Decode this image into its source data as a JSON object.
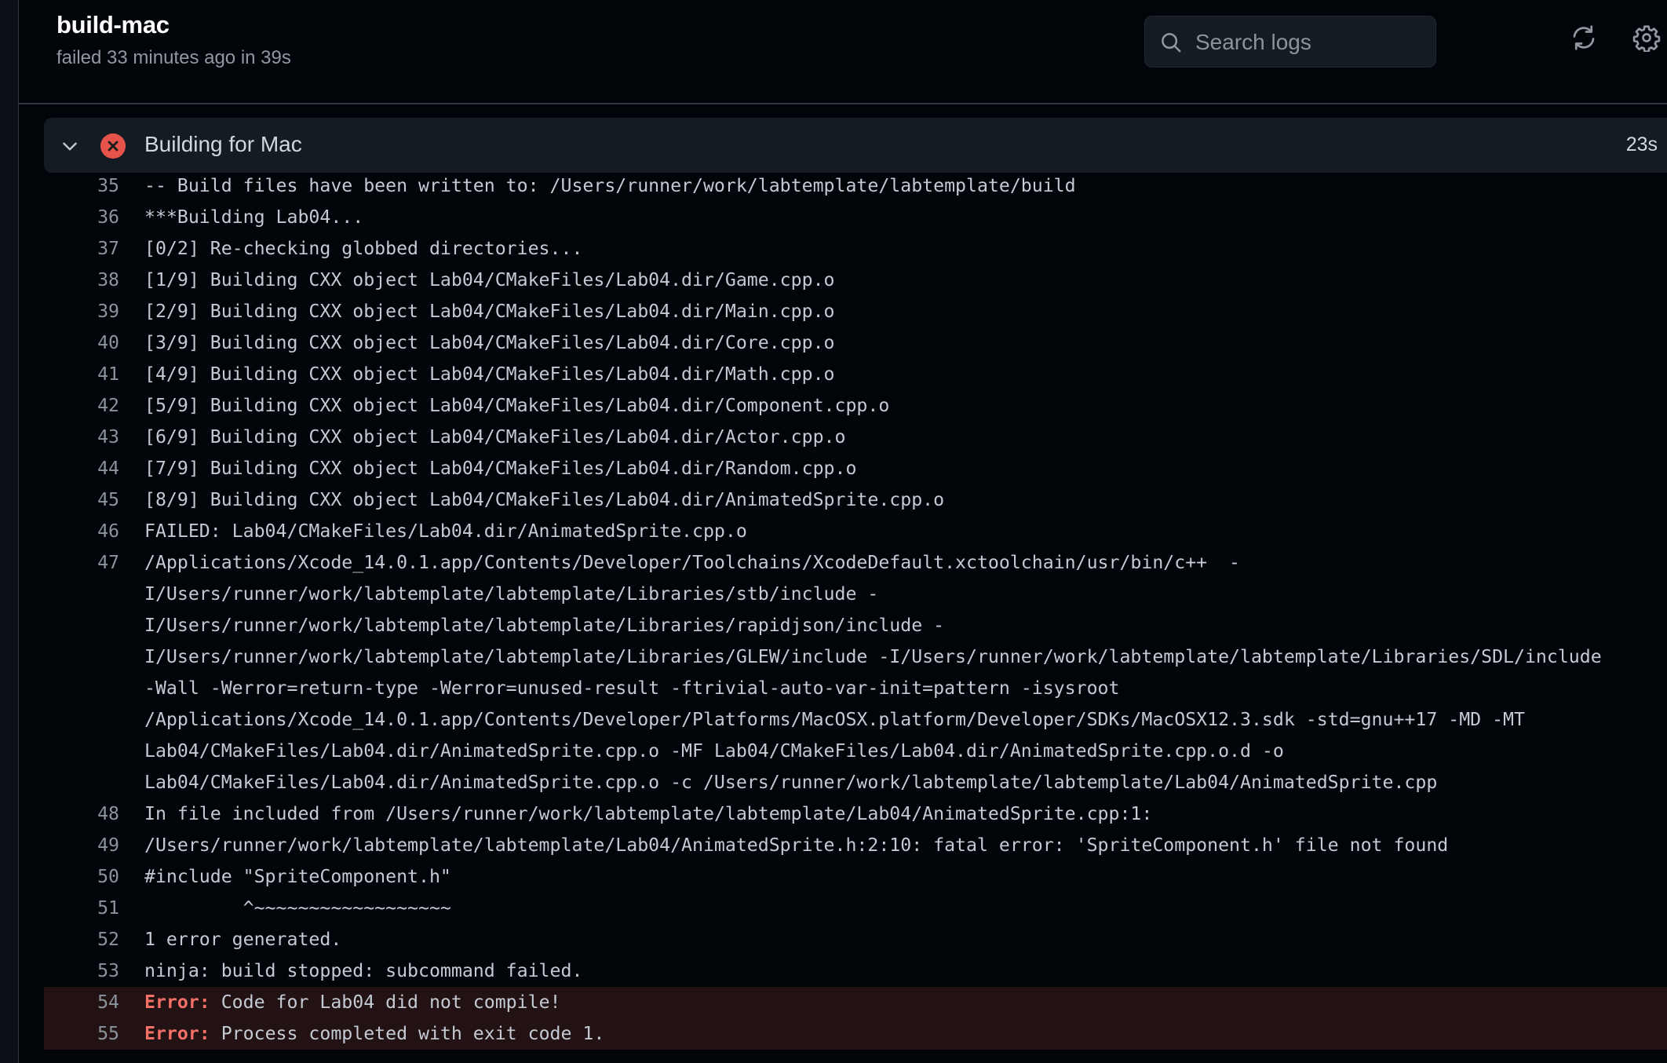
{
  "job": {
    "title": "build-mac",
    "status": "failed 33 minutes ago in 39s"
  },
  "toolbar": {
    "search_placeholder": "Search logs",
    "refresh_icon": "sync-icon",
    "settings_icon": "gear-icon"
  },
  "step": {
    "title": "Building for Mac",
    "duration": "23s",
    "status": "failed",
    "status_color": "#e5534b",
    "expanded": true
  },
  "log": {
    "lines": [
      {
        "n": "35",
        "text": "-- Build files have been written to: /Users/runner/work/labtemplate/labtemplate/build"
      },
      {
        "n": "36",
        "text": "***Building Lab04..."
      },
      {
        "n": "37",
        "text": "[0/2] Re-checking globbed directories..."
      },
      {
        "n": "38",
        "text": "[1/9] Building CXX object Lab04/CMakeFiles/Lab04.dir/Game.cpp.o"
      },
      {
        "n": "39",
        "text": "[2/9] Building CXX object Lab04/CMakeFiles/Lab04.dir/Main.cpp.o"
      },
      {
        "n": "40",
        "text": "[3/9] Building CXX object Lab04/CMakeFiles/Lab04.dir/Core.cpp.o"
      },
      {
        "n": "41",
        "text": "[4/9] Building CXX object Lab04/CMakeFiles/Lab04.dir/Math.cpp.o"
      },
      {
        "n": "42",
        "text": "[5/9] Building CXX object Lab04/CMakeFiles/Lab04.dir/Component.cpp.o"
      },
      {
        "n": "43",
        "text": "[6/9] Building CXX object Lab04/CMakeFiles/Lab04.dir/Actor.cpp.o"
      },
      {
        "n": "44",
        "text": "[7/9] Building CXX object Lab04/CMakeFiles/Lab04.dir/Random.cpp.o"
      },
      {
        "n": "45",
        "text": "[8/9] Building CXX object Lab04/CMakeFiles/Lab04.dir/AnimatedSprite.cpp.o"
      },
      {
        "n": "46",
        "text": "FAILED: Lab04/CMakeFiles/Lab04.dir/AnimatedSprite.cpp.o"
      },
      {
        "n": "47",
        "text": "/Applications/Xcode_14.0.1.app/Contents/Developer/Toolchains/XcodeDefault.xctoolchain/usr/bin/c++  -"
      },
      {
        "n": "",
        "text": "I/Users/runner/work/labtemplate/labtemplate/Libraries/stb/include -"
      },
      {
        "n": "",
        "text": "I/Users/runner/work/labtemplate/labtemplate/Libraries/rapidjson/include -"
      },
      {
        "n": "",
        "text": "I/Users/runner/work/labtemplate/labtemplate/Libraries/GLEW/include -I/Users/runner/work/labtemplate/labtemplate/Libraries/SDL/include"
      },
      {
        "n": "",
        "text": "-Wall -Werror=return-type -Werror=unused-result -ftrivial-auto-var-init=pattern -isysroot"
      },
      {
        "n": "",
        "text": "/Applications/Xcode_14.0.1.app/Contents/Developer/Platforms/MacOSX.platform/Developer/SDKs/MacOSX12.3.sdk -std=gnu++17 -MD -MT"
      },
      {
        "n": "",
        "text": "Lab04/CMakeFiles/Lab04.dir/AnimatedSprite.cpp.o -MF Lab04/CMakeFiles/Lab04.dir/AnimatedSprite.cpp.o.d -o"
      },
      {
        "n": "",
        "text": "Lab04/CMakeFiles/Lab04.dir/AnimatedSprite.cpp.o -c /Users/runner/work/labtemplate/labtemplate/Lab04/AnimatedSprite.cpp"
      },
      {
        "n": "48",
        "text": "In file included from /Users/runner/work/labtemplate/labtemplate/Lab04/AnimatedSprite.cpp:1:"
      },
      {
        "n": "49",
        "text": "/Users/runner/work/labtemplate/labtemplate/Lab04/AnimatedSprite.h:2:10: fatal error: 'SpriteComponent.h' file not found"
      },
      {
        "n": "50",
        "text": "#include \"SpriteComponent.h\""
      },
      {
        "n": "51",
        "text": "         ^~~~~~~~~~~~~~~~~~~"
      },
      {
        "n": "52",
        "text": "1 error generated."
      },
      {
        "n": "53",
        "text": "ninja: build stopped: subcommand failed."
      }
    ],
    "error_lines": [
      {
        "n": "54",
        "label": "Error:",
        "text": " Code for Lab04 did not compile!"
      },
      {
        "n": "55",
        "label": "Error:",
        "text": " Process completed with exit code 1."
      }
    ]
  }
}
